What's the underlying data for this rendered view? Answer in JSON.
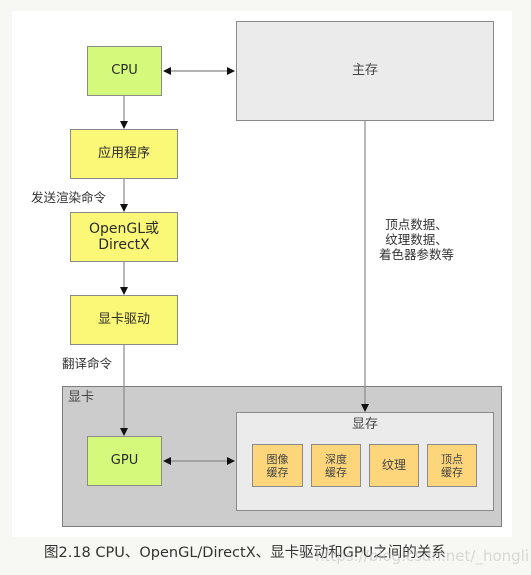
{
  "diagram": {
    "nodes": {
      "cpu": "CPU",
      "main_memory": "主存",
      "application": "应用程序",
      "graphics_api_line1": "OpenGL或",
      "graphics_api_line2": "DirectX",
      "driver": "显卡驱动",
      "graphics_card": "显卡",
      "gpu": "GPU",
      "vram": "显存",
      "buffers": [
        {
          "line1": "图像",
          "line2": "缓存"
        },
        {
          "line1": "深度",
          "line2": "缓存"
        },
        {
          "line1": "纹理",
          "line2": ""
        },
        {
          "line1": "顶点",
          "line2": "缓存"
        }
      ]
    },
    "edge_labels": {
      "send_render_commands": "发送渲染命令",
      "translate_commands": "翻译命令",
      "data_transfer_line1": "顶点数据、",
      "data_transfer_line2": "纹理数据、",
      "data_transfer_line3": "着色器参数等"
    },
    "colors": {
      "cpu_gpu": "#d5f97a",
      "software_layers": "#fbf777",
      "memory": "#ebebeb",
      "graphics_card": "#cccccc",
      "buffers": "#fdd67c"
    }
  },
  "caption": "图2.18 CPU、OpenGL/DirectX、显卡驱动和GPU之间的关系",
  "watermark": "https://blog.csdn.net/_hongli"
}
